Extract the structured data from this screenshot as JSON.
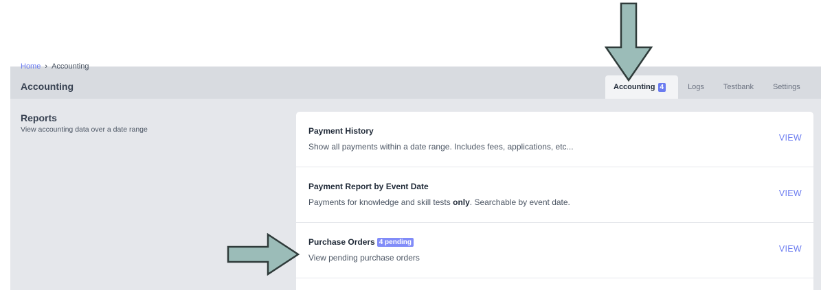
{
  "breadcrumb": {
    "home": "Home",
    "separator": "›",
    "current": "Accounting"
  },
  "page_title": "Accounting",
  "tabs": [
    {
      "label": "Accounting",
      "badge": "4",
      "active": true
    },
    {
      "label": "Logs"
    },
    {
      "label": "Testbank"
    },
    {
      "label": "Settings"
    }
  ],
  "reports": {
    "title": "Reports",
    "subtitle": "View accounting data over a date range"
  },
  "rows": [
    {
      "title": "Payment History",
      "desc": "Show all payments within a date range. Includes fees, applications, etc...",
      "view": "VIEW"
    },
    {
      "title": "Payment Report by Event Date",
      "desc_before": "Payments for knowledge and skill tests ",
      "desc_bold": "only",
      "desc_after": ". Searchable by event date.",
      "view": "VIEW"
    },
    {
      "title": "Purchase Orders",
      "badge": "4 pending",
      "desc": "View pending purchase orders",
      "view": "VIEW"
    }
  ],
  "colors": {
    "accent": "#6b7cf0",
    "arrow_fill": "#9bbcb8",
    "arrow_stroke": "#2f3b3a"
  },
  "annotations": [
    "down-arrow-icon",
    "right-arrow-icon"
  ]
}
